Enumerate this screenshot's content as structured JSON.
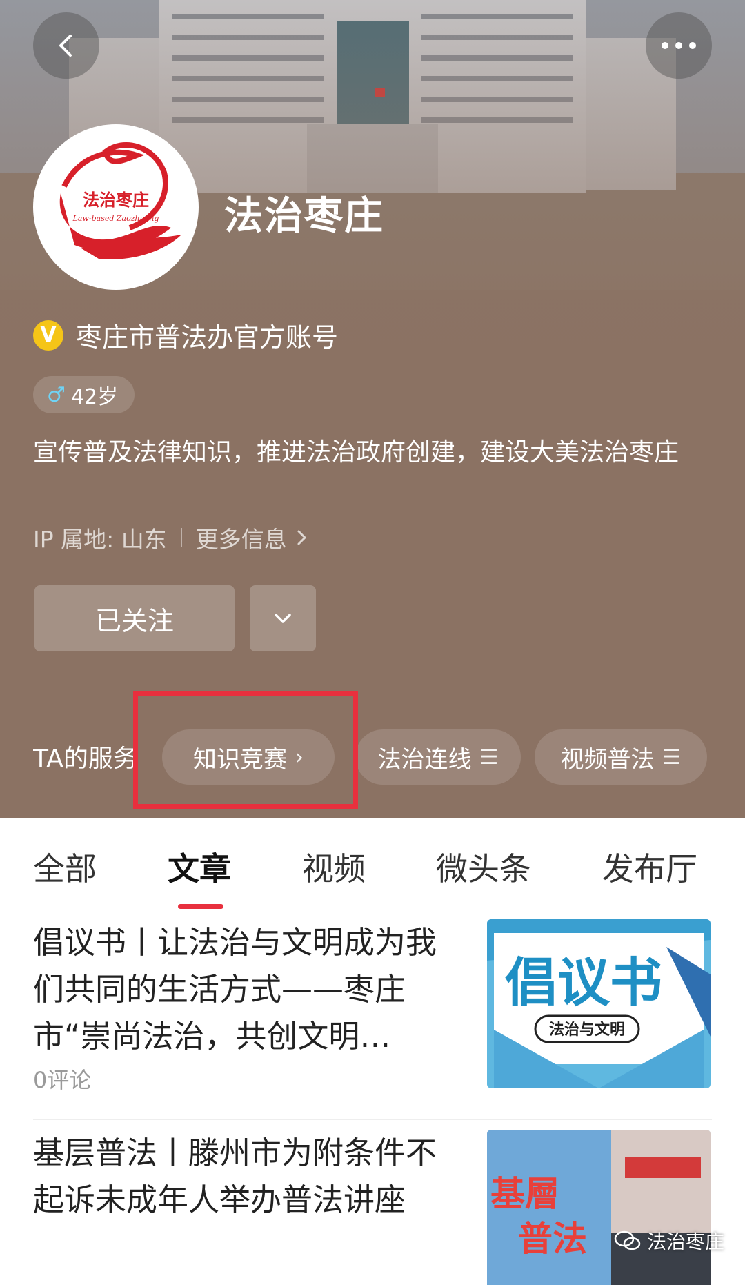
{
  "header": {
    "back_icon": "back-arrow-icon",
    "more_icon": "more-dots-icon",
    "account_name": "法治枣庄",
    "logo_text": "法治枣庄",
    "logo_subtext": "Law-based Zaozhuang",
    "verify_badge": "V",
    "verify_text": "枣庄市普法办官方账号",
    "age_symbol": "♂",
    "age_text": "42岁",
    "bio": "宣传普及法律知识，推进法治政府创建，建设大美法治枣庄",
    "ip_location": "IP 属地: 山东",
    "more_info": "更多信息",
    "follow_label": "已关注"
  },
  "services": {
    "label": "TA的服务",
    "items": [
      {
        "label": "知识竞赛",
        "glyph": "›"
      },
      {
        "label": "法治连线",
        "glyph": "☰"
      },
      {
        "label": "视频普法",
        "glyph": "☰"
      }
    ]
  },
  "tabs": {
    "items": [
      "全部",
      "文章",
      "视频",
      "微头条",
      "发布厅"
    ],
    "active": "文章"
  },
  "articles": [
    {
      "title": "倡议书丨让法治与文明成为我们共同的生活方式——枣庄市“崇尚法治，共创文明…",
      "comments": "0评论",
      "thumb_big_text": "倡议书",
      "thumb_small_text": "法治与文明"
    },
    {
      "title": "基层普法丨滕州市为附条件不起诉未成年人举办普法讲座",
      "thumb_text_line1": "基層",
      "thumb_text_line2": "普法"
    }
  ],
  "watermark": "法治枣庄",
  "colors": {
    "accent_red": "#e8303e",
    "header_brown": "#8a7262",
    "verify_gold": "#f5c518"
  }
}
